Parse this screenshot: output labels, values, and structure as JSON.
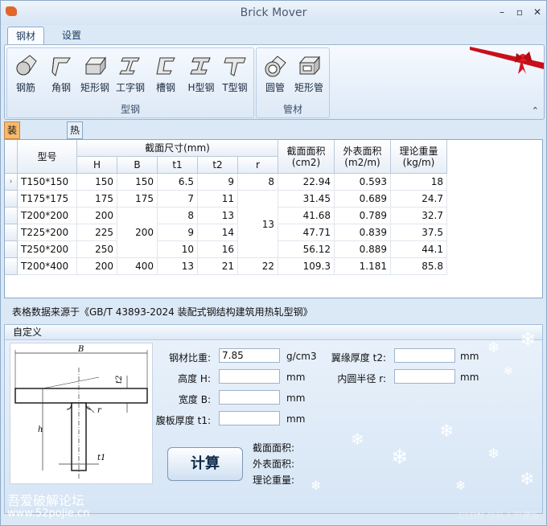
{
  "window": {
    "title": "Brick Mover"
  },
  "ribbon": {
    "tabs": [
      "钢材",
      "设置"
    ],
    "group1": {
      "label": "型钢",
      "buttons": [
        "钢筋",
        "角钢",
        "矩形钢",
        "工字钢",
        "槽钢",
        "H型钢",
        "T型钢"
      ]
    },
    "group2": {
      "label": "管材",
      "buttons": [
        "圆管",
        "矩形管"
      ]
    }
  },
  "subtabs": [
    "装配式T型钢",
    "热轧T型钢"
  ],
  "table": {
    "col_model": "型号",
    "col_section": "截面尺寸(mm)",
    "sub_cols": [
      "H",
      "B",
      "t1",
      "t2",
      "r"
    ],
    "col_area": "截面面积\n(cm2)",
    "col_surface": "外表面积\n(m2/m)",
    "col_weight": "理论重量\n(kg/m)",
    "rows": [
      {
        "model": "T150*150",
        "H": "150",
        "B": "150",
        "t1": "6.5",
        "t2": "9",
        "r": "8",
        "area": "22.94",
        "surface": "0.593",
        "weight": "18"
      },
      {
        "model": "T175*175",
        "H": "175",
        "B": "175",
        "t1": "7",
        "t2": "11",
        "r": "",
        "area": "31.45",
        "surface": "0.689",
        "weight": "24.7"
      },
      {
        "model": "T200*200",
        "H": "200",
        "B": "",
        "t1": "8",
        "t2": "13",
        "r": "",
        "area": "41.68",
        "surface": "0.789",
        "weight": "32.7"
      },
      {
        "model": "T225*200",
        "H": "225",
        "B": "",
        "t1": "9",
        "t2": "14",
        "r": "",
        "area": "47.71",
        "surface": "0.839",
        "weight": "37.5"
      },
      {
        "model": "T250*200",
        "H": "250",
        "B": "",
        "t1": "10",
        "t2": "16",
        "r": "",
        "area": "56.12",
        "surface": "0.889",
        "weight": "44.1"
      },
      {
        "model": "T200*400",
        "H": "200",
        "B": "400",
        "t1": "13",
        "t2": "21",
        "r": "22",
        "area": "109.3",
        "surface": "1.181",
        "weight": "85.8"
      }
    ],
    "merged_B": "200",
    "merged_r": "13"
  },
  "source_note": "表格数据来源于《GB/T 43893-2024 装配式钢结构建筑用热轧型钢》",
  "custom": {
    "title": "自定义",
    "density_label": "钢材比重:",
    "density_value": "7.85",
    "density_unit": "g/cm3",
    "height_label": "高度 H:",
    "height_unit": "mm",
    "width_label": "宽度 B:",
    "width_unit": "mm",
    "web_label": "腹板厚度 t1:",
    "web_unit": "mm",
    "flange_label": "翼缘厚度 t2:",
    "flange_unit": "mm",
    "radius_label": "内圆半径 r:",
    "radius_unit": "mm",
    "calc_label": "计算",
    "res_area": "截面面积:",
    "res_surface": "外表面积:",
    "res_weight": "理论重量:",
    "diagram": {
      "B": "B",
      "t2": "t2",
      "r": "r",
      "h": "h",
      "t1": "t1"
    }
  },
  "watermark": {
    "line1": "吾爱破解论坛",
    "line2": "www.52pojie.cn",
    "credit": "CSDN @私人珍藏版"
  }
}
